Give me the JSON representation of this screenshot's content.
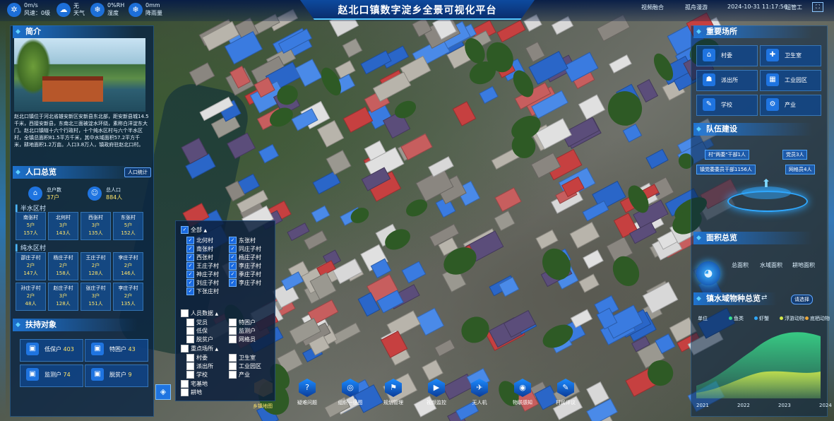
{
  "title": "赵北口镇数字淀乡全景可视化平台",
  "header": {
    "weather": [
      {
        "value": "0m/s",
        "label": "风速：0级",
        "icon": "wind-icon"
      },
      {
        "value": "无",
        "label": "天气",
        "icon": "weather-icon"
      },
      {
        "value": "0%RH",
        "label": "湿度",
        "icon": "humidity-icon"
      },
      {
        "value": "0mm",
        "label": "降雨量",
        "icon": "rain-icon"
      }
    ],
    "nav_link": "视频融合",
    "user": "孤舟漫游",
    "datetime": "2024-10-31 11:17:56",
    "user_name": "超管工"
  },
  "intro": {
    "title": "简介",
    "text": "赵北口镇位于河北省雄安新区安新县东北部，距安新县城14.5千米，西接安新县，东南北三面被淀水环绕，素称白洋淀东大门。赵北口镇辖十六个行政村，十个纯水区村与六个半水区村，全镇总面积81.5平方千米，其中水域面积57.2平方千米，耕地面积1.2万亩。人口3.8万人，镇政府驻赵北口村。"
  },
  "population": {
    "title": "人口总览",
    "button": "人口统计",
    "total_label": "总户数",
    "total_value": "37户",
    "people_label": "总人口",
    "people_value": "884人",
    "half_water_title": "半水区村",
    "half_water": [
      {
        "name": "南张村",
        "households": "5户",
        "people": "157人"
      },
      {
        "name": "北何村",
        "households": "3户",
        "people": "143人"
      },
      {
        "name": "西张村",
        "households": "3户",
        "people": "135人"
      },
      {
        "name": "东张村",
        "households": "5户",
        "people": "152人"
      }
    ],
    "full_water_title": "纯水区村",
    "full_water": [
      {
        "name": "邵庄子村",
        "households": "2户",
        "people": "147人"
      },
      {
        "name": "杨庄子村",
        "households": "2户",
        "people": "158人"
      },
      {
        "name": "王庄子村",
        "households": "2户",
        "people": "128人"
      },
      {
        "name": "李庄子村",
        "households": "2户",
        "people": "146人"
      },
      {
        "name": "孙庄子村",
        "households": "2户",
        "people": "48人"
      },
      {
        "name": "赵庄子村",
        "households": "3户",
        "people": "128人"
      },
      {
        "name": "张庄子村",
        "households": "3户",
        "people": "151人"
      },
      {
        "name": "李庄子村",
        "households": "2户",
        "people": "135人"
      }
    ]
  },
  "support": {
    "title": "扶持对象",
    "items": [
      {
        "label": "低保户",
        "value": "403",
        "icon": "shield-icon"
      },
      {
        "label": "特困户",
        "value": "43",
        "icon": "user-icon"
      },
      {
        "label": "监测户",
        "value": "74",
        "icon": "monitor-icon"
      },
      {
        "label": "脱贫户",
        "value": "9",
        "icon": "house-icon"
      }
    ]
  },
  "filter": {
    "all_label": "全部",
    "villages_left": [
      "北何村",
      "南张村",
      "西张村",
      "王庄子村",
      "神庄子村",
      "刘庄子村",
      "下张庄村"
    ],
    "villages_right": [
      "东张村",
      "同庄子村",
      "杨庄子村",
      "李庄子村",
      "季庄子村",
      "李庄子村"
    ],
    "people_title": "人员数据",
    "people_items_left": [
      "党员",
      "低保",
      "脱贫户"
    ],
    "people_items_right": [
      "特困户",
      "监测户",
      "网格员"
    ],
    "key_places_title": "重点场所",
    "places_left": [
      "村委",
      "派出所",
      "学校"
    ],
    "places_right": [
      "卫生室",
      "工业园区",
      "产业"
    ],
    "homestead": "宅基地",
    "farmland": "耕地"
  },
  "key_places": {
    "title": "重要场所",
    "items": [
      {
        "label": "村委",
        "icon": "building-icon"
      },
      {
        "label": "卫生室",
        "icon": "medical-icon"
      },
      {
        "label": "派出所",
        "icon": "police-icon"
      },
      {
        "label": "工业园区",
        "icon": "factory-icon"
      },
      {
        "label": "学校",
        "icon": "school-icon"
      },
      {
        "label": "产业",
        "icon": "industry-icon"
      }
    ]
  },
  "team": {
    "title": "队伍建设",
    "tags": [
      "村\"两委\"干部1人",
      "党员3人",
      "镇党委委员干部1156人",
      "网格员4人"
    ]
  },
  "area": {
    "title": "面积总览",
    "labels": [
      "总面积",
      "水域面积",
      "耕地面积"
    ]
  },
  "water": {
    "title": "镇水域物种总览",
    "button": "请选择",
    "legend": [
      {
        "name": "鱼类",
        "color": "#39d98a"
      },
      {
        "name": "虾蟹",
        "color": "#2fa8ff"
      },
      {
        "name": "浮游动物",
        "color": "#d4e84a"
      },
      {
        "name": "底栖动物",
        "color": "#e8a63a"
      }
    ],
    "unit": "单位",
    "years": [
      "2021",
      "2022",
      "2023",
      "2024"
    ]
  },
  "bottom_nav": [
    {
      "label": "疑难问题",
      "icon": "question-icon"
    },
    {
      "label": "组织一张图",
      "icon": "org-icon"
    },
    {
      "label": "规划管理",
      "icon": "plan-icon"
    },
    {
      "label": "视频监控",
      "icon": "camera-icon"
    },
    {
      "label": "无人机",
      "icon": "drone-icon"
    },
    {
      "label": "物联感知",
      "icon": "iot-icon"
    },
    {
      "label": "村民评议",
      "icon": "vote-icon"
    }
  ],
  "terrain_label": "乡镇地图"
}
